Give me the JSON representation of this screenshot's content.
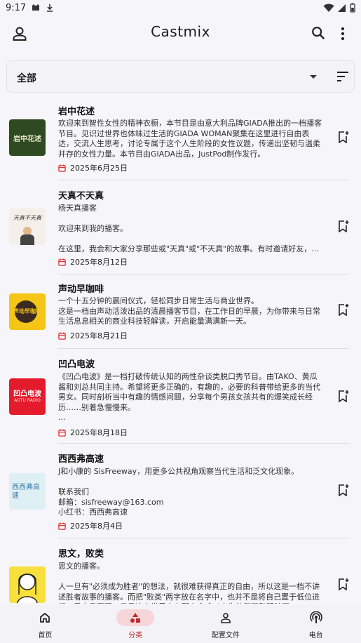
{
  "status_bar": {
    "time": "9:17"
  },
  "app": {
    "title": "Castmix"
  },
  "filter": {
    "label": "全部"
  },
  "colors": {
    "accent": "#c0282f",
    "date_icon": "#e0312f",
    "active_nav_bg": "#f6d6d8"
  },
  "items": [
    {
      "title": "岩中花述",
      "desc": "欢迎来到智性女性的精神衣橱，本节目是由意大利品牌GIADA推出的一档播客节目。见识过世界也体味过生活的GIADA WOMAN聚集在这里进行自由表达，交流人生思考，讨论专属于这个人生阶段的女性议题，传递出坚韧与温柔并存的女性力量。本节目由GIADA出品，JustPod制作发行。",
      "date": "2025年6月25日",
      "thumb_text": "岩中花述"
    },
    {
      "title": "天真不天真",
      "desc": "杨天真播客\n\n欢迎来到我的播客。\n\n在这里，我会和大家分享那些或\"天真\"或\"不天真\"的故事。有时邀请好友，…",
      "date": "2025年8月12日",
      "thumb_text": "天真不天真"
    },
    {
      "title": "声动早咖啡",
      "desc": "一个十五分钟的晨间仪式，轻松同步日常生活与商业世界。\n这是一档由声动活泼出品的清晨播客节目，在工作日的早晨，为你带来与日常生活息息相关的商业科技轻解读，开启能量满满新一天。",
      "date": "2025年8月21日",
      "thumb_text": "声动早咖啡"
    },
    {
      "title": "凹凸电波",
      "desc": "《凹凸电波》是一档打破传统认知的两性杂谈类脱口秀节目。由TAKO、黄瓜酱和刘总共同主持。希望将更多正确的，有趣的，必要的科普带给更多的当代男女。同时剖析当中有趣的情感问题，分享每个男孩女孩共有的爆笑成长经历……别着急慢慢来。\n...",
      "date": "2025年8月18日",
      "thumb_text": "凹凸电波",
      "thumb_subtext": "AOTU RADIO"
    },
    {
      "title": "西西弗高速",
      "desc": "J和小康的 SisFreeway，用更多公共视角观察当代生活和泛文化现象。\n\n联系我们\n邮箱：sisfreeway@163.com\n小红书：西西弗高速",
      "date": "2025年8月4日",
      "thumb_text": "西西弗高速"
    },
    {
      "title": "思文，败类",
      "desc": "思文的播客。\n\n人一旦有\"必须成为胜者\"的想法，就很难获得真正的自由，所以这是一档不讲述胜者故事的播客。而把\"败类\"两字放在名字中，也并不是将自己置于低位进行一番自我菲薄，只是这个世界上有那么多难以启齿的卫丽和阴暗面",
      "date": "",
      "thumb_text": ""
    }
  ],
  "nav": [
    {
      "label": "首页",
      "icon": "home-icon"
    },
    {
      "label": "分类",
      "icon": "category-icon",
      "active": true
    },
    {
      "label": "配置文件",
      "icon": "profile-icon"
    },
    {
      "label": "电台",
      "icon": "podcast-icon"
    }
  ]
}
